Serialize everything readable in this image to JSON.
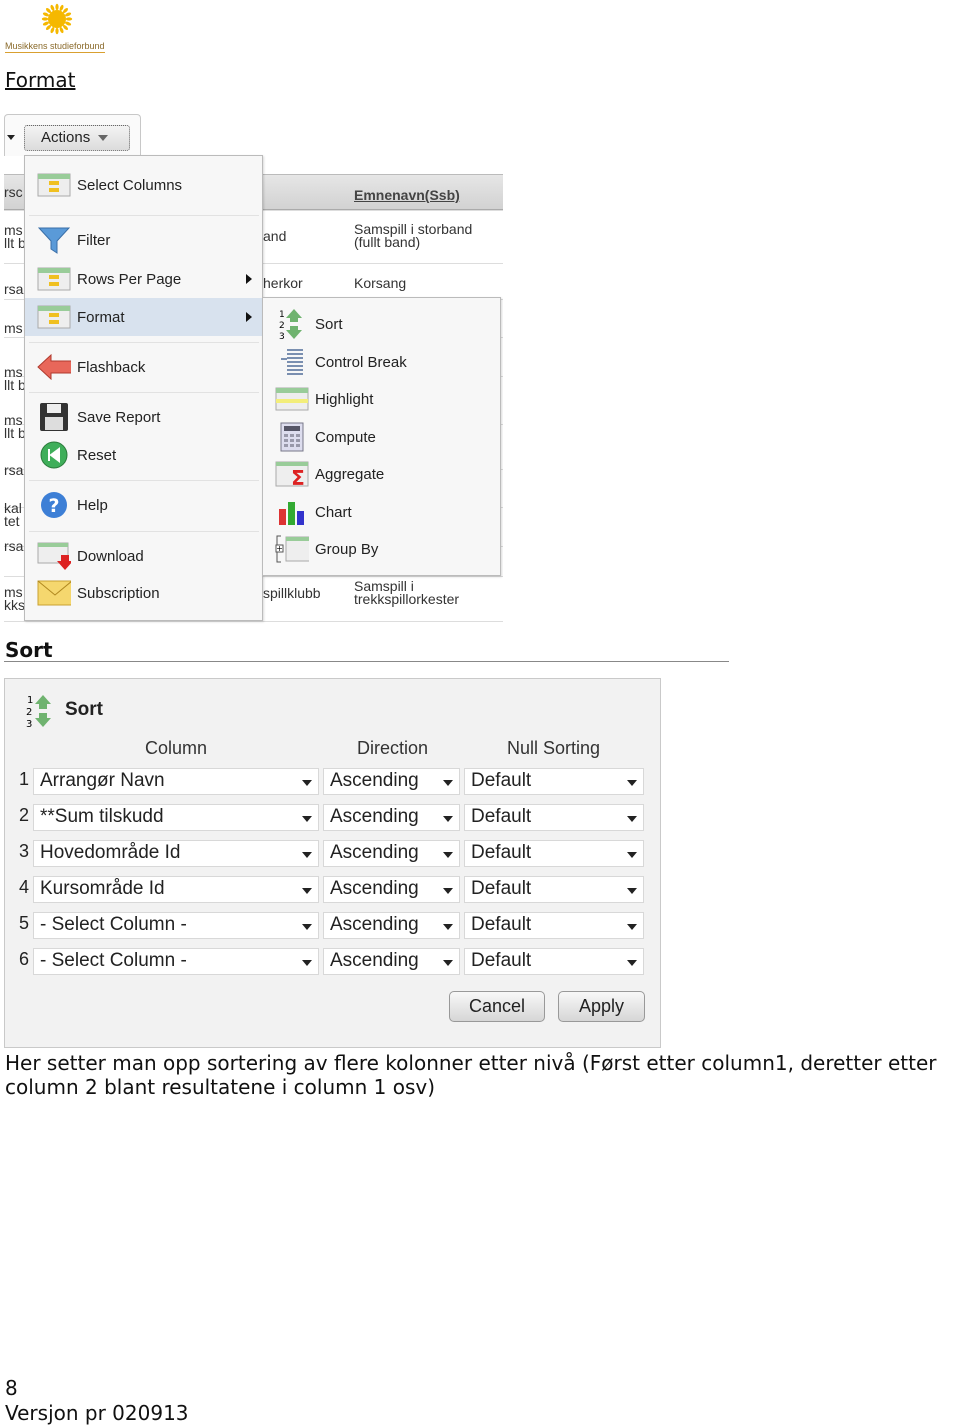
{
  "logo": {
    "text": "Musikkens studieforbund",
    "color": "#f5b800"
  },
  "heading_link": "Format",
  "screenshot_menu": {
    "actions_label": "Actions",
    "table_header": "Emnenavn(Ssb)",
    "left_fragments": [
      "rsc",
      "ms\nllt b",
      "rsa",
      "ms",
      "ms\nllt b",
      "ms\nllt b",
      "rsa",
      "kal\ntet",
      "rsa",
      "ms\nkks"
    ],
    "mid_fragments": [
      "and",
      "herkor",
      "spillklubb"
    ],
    "right_fragments": [
      "Samspill i storband\n(fullt band)",
      "Korsang",
      "Samspill i\ntrekkspillorkester"
    ],
    "menu_items": [
      {
        "label": "Select Columns",
        "icon": "select-columns-icon"
      },
      {
        "label": "Filter",
        "icon": "filter-funnel-icon"
      },
      {
        "label": "Rows Per Page",
        "icon": "rows-per-page-icon",
        "submenu": true
      },
      {
        "label": "Format",
        "icon": "format-icon",
        "submenu": true,
        "highlighted": true
      },
      {
        "label": "Flashback",
        "icon": "flashback-arrow-icon"
      },
      {
        "label": "Save Report",
        "icon": "floppy-disk-icon"
      },
      {
        "label": "Reset",
        "icon": "reset-icon"
      },
      {
        "label": "Help",
        "icon": "help-icon"
      },
      {
        "label": "Download",
        "icon": "download-icon"
      },
      {
        "label": "Subscription",
        "icon": "envelope-icon"
      }
    ],
    "submenu_items": [
      {
        "label": "Sort",
        "icon": "sort-icon"
      },
      {
        "label": "Control Break",
        "icon": "control-break-icon"
      },
      {
        "label": "Highlight",
        "icon": "highlight-icon"
      },
      {
        "label": "Compute",
        "icon": "calculator-icon"
      },
      {
        "label": "Aggregate",
        "icon": "sigma-icon"
      },
      {
        "label": "Chart",
        "icon": "bar-chart-icon"
      },
      {
        "label": "Group By",
        "icon": "group-by-icon"
      }
    ]
  },
  "sort_heading": "Sort",
  "sort_dialog": {
    "title": "Sort",
    "headers": {
      "column": "Column",
      "direction": "Direction",
      "null_sorting": "Null Sorting"
    },
    "rows": [
      {
        "n": "1",
        "column": "Arrangør Navn",
        "direction": "Ascending",
        "null_sorting": "Default"
      },
      {
        "n": "2",
        "column": "**Sum tilskudd",
        "direction": "Ascending",
        "null_sorting": "Default"
      },
      {
        "n": "3",
        "column": "Hovedområde Id",
        "direction": "Ascending",
        "null_sorting": "Default"
      },
      {
        "n": "4",
        "column": "Kursområde Id",
        "direction": "Ascending",
        "null_sorting": "Default"
      },
      {
        "n": "5",
        "column": "- Select Column -",
        "direction": "Ascending",
        "null_sorting": "Default"
      },
      {
        "n": "6",
        "column": "- Select Column -",
        "direction": "Ascending",
        "null_sorting": "Default"
      }
    ],
    "cancel_label": "Cancel",
    "apply_label": "Apply"
  },
  "paragraph": "Her setter man opp sortering av flere kolonner etter nivå (Først etter column1, deretter etter column 2 blant resultatene i column 1 osv)",
  "footer": {
    "page_number": "8",
    "version": "Versjon pr 020913"
  }
}
